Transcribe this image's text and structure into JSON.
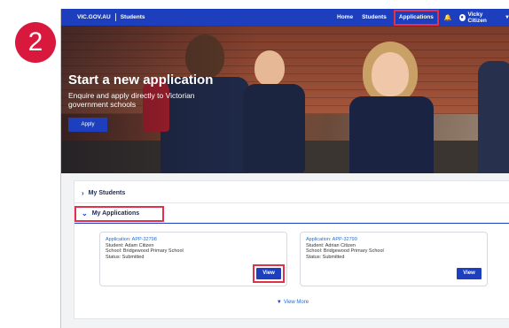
{
  "step": "2",
  "nav": {
    "brand": "VIC.GOV.AU",
    "section": "Students",
    "links": [
      "Home",
      "Students",
      "Applications"
    ],
    "active_link": "Applications",
    "user": "Vicky Citizen"
  },
  "hero": {
    "title": "Start a new application",
    "subtitle": "Enquire and apply directly to Victorian government schools",
    "apply_label": "Apply"
  },
  "sections": {
    "students": "My Students",
    "applications": "My Applications"
  },
  "applications": [
    {
      "application": "Application: APP-32798",
      "student": "Student:  Adam Citizen",
      "school": "School: Bridgewood Primary School",
      "status": "Status: Submitted",
      "view_label": "View"
    },
    {
      "application": "Application: APP-32799",
      "student": "Student:  Adrian Citizen",
      "school": "School: Bridgewood Primary School",
      "status": "Status: Submitted",
      "view_label": "View"
    }
  ],
  "view_more": "View More",
  "colors": {
    "accent": "#1d3fbe",
    "highlight": "#e2314a",
    "badge": "#d8183c"
  }
}
